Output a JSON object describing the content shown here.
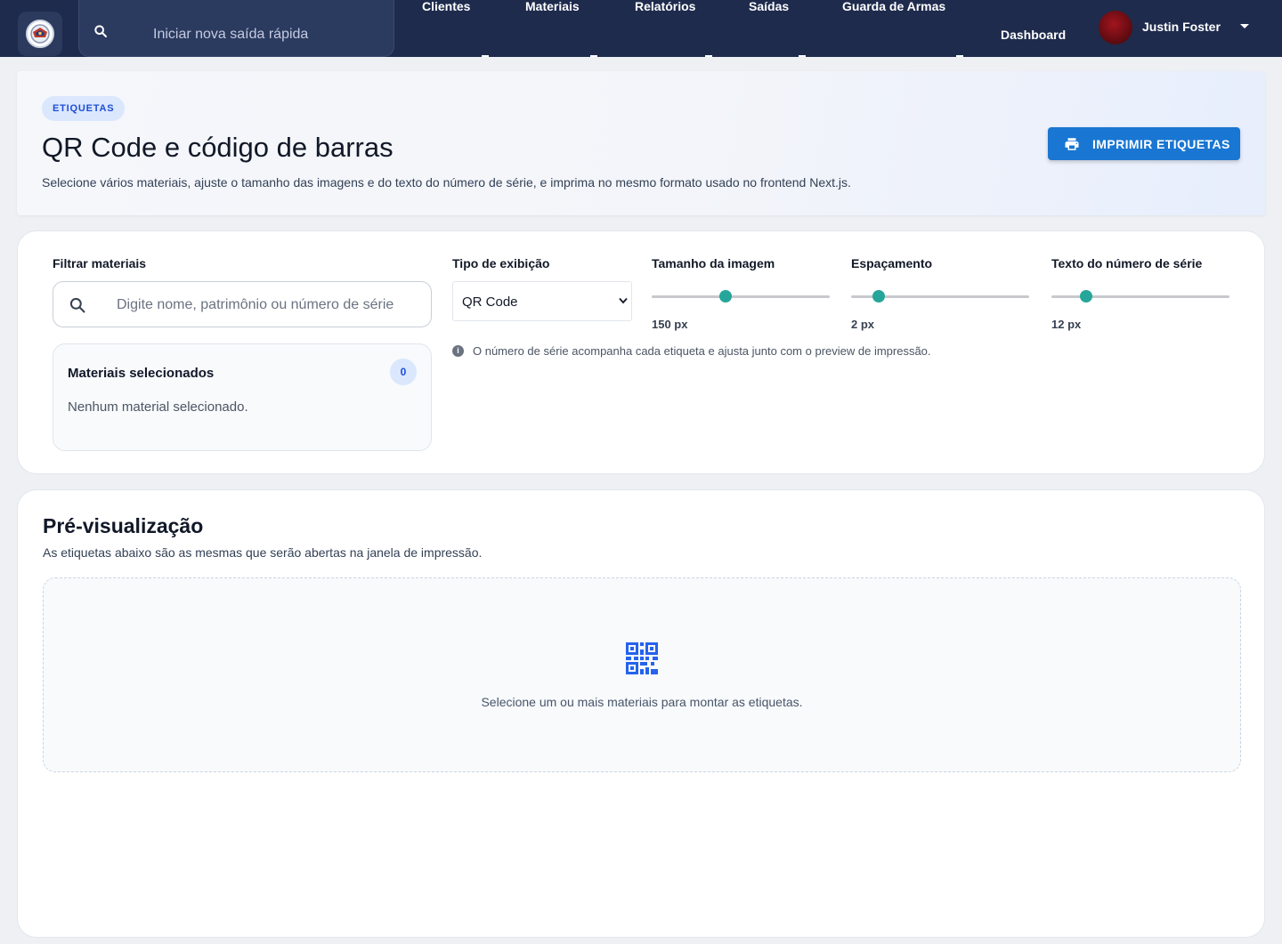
{
  "topbar": {
    "quick_search_placeholder": "Iniciar nova saída rápida",
    "nav": [
      "Clientes",
      "Materiais",
      "Relatórios",
      "Saídas",
      "Guarda de Armas"
    ],
    "dashboard": "Dashboard",
    "user_name": "Justin Foster"
  },
  "header": {
    "chip": "ETIQUETAS",
    "title": "QR Code e código de barras",
    "subtitle": "Selecione vários materiais, ajuste o tamanho das imagens e do texto do número de série, e imprima no mesmo formato usado no frontend Next.js.",
    "print_button": "IMPRIMIR ETIQUETAS"
  },
  "filters": {
    "filter_label": "Filtrar materiais",
    "search_placeholder": "Digite nome, patrimônio ou número de série",
    "selected_title": "Materiais selecionados",
    "selected_count": "0",
    "selected_empty": "Nenhum material selecionado.",
    "display_type_label": "Tipo de exibição",
    "display_type_value": "QR Code",
    "image_size_label": "Tamanho da imagem",
    "image_size_value": "150 px",
    "image_size_fraction": 0.41,
    "spacing_label": "Espaçamento",
    "spacing_value": "2 px",
    "spacing_fraction": 0.13,
    "serial_text_label": "Texto do número de série",
    "serial_text_value": "12 px",
    "serial_text_fraction": 0.17,
    "info": "O número de série acompanha cada etiqueta e ajusta junto com o preview de impressão."
  },
  "preview": {
    "title": "Pré-visualização",
    "subtitle": "As etiquetas abaixo são as mesmas que serão abertas na janela de impressão.",
    "empty": "Selecione um ou mais materiais para montar as etiquetas."
  },
  "colors": {
    "topbar": "#1e2b4d",
    "accent": "#1976d2",
    "slider": "#26a69a",
    "chip_text": "#1d4ed8"
  },
  "icons": {
    "quick_search": "search-icon",
    "filter_search": "search-icon",
    "print": "printer-icon",
    "info": "info-icon",
    "preview": "qr-code-icon",
    "user_menu": "caret-down-icon"
  }
}
